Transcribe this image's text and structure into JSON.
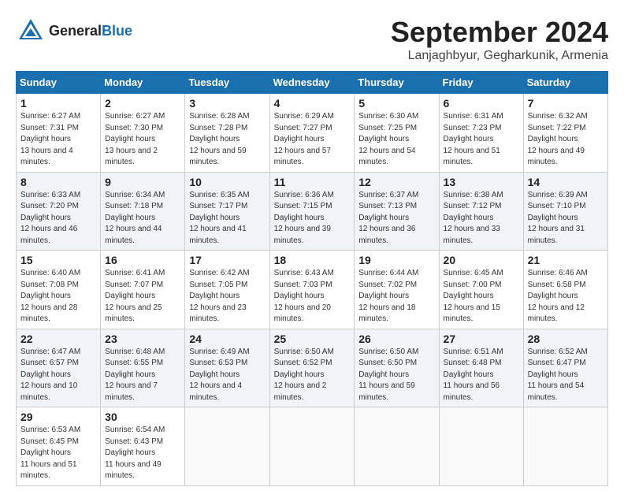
{
  "header": {
    "logo_general": "General",
    "logo_blue": "Blue",
    "month_title": "September 2024",
    "location": "Lanjaghbyur, Gegharkunik, Armenia"
  },
  "weekdays": [
    "Sunday",
    "Monday",
    "Tuesday",
    "Wednesday",
    "Thursday",
    "Friday",
    "Saturday"
  ],
  "weeks": [
    [
      {
        "day": 1,
        "sunrise": "6:27 AM",
        "sunset": "7:31 PM",
        "daylight": "13 hours and 4 minutes"
      },
      {
        "day": 2,
        "sunrise": "6:27 AM",
        "sunset": "7:30 PM",
        "daylight": "13 hours and 2 minutes"
      },
      {
        "day": 3,
        "sunrise": "6:28 AM",
        "sunset": "7:28 PM",
        "daylight": "12 hours and 59 minutes"
      },
      {
        "day": 4,
        "sunrise": "6:29 AM",
        "sunset": "7:27 PM",
        "daylight": "12 hours and 57 minutes"
      },
      {
        "day": 5,
        "sunrise": "6:30 AM",
        "sunset": "7:25 PM",
        "daylight": "12 hours and 54 minutes"
      },
      {
        "day": 6,
        "sunrise": "6:31 AM",
        "sunset": "7:23 PM",
        "daylight": "12 hours and 51 minutes"
      },
      {
        "day": 7,
        "sunrise": "6:32 AM",
        "sunset": "7:22 PM",
        "daylight": "12 hours and 49 minutes"
      }
    ],
    [
      {
        "day": 8,
        "sunrise": "6:33 AM",
        "sunset": "7:20 PM",
        "daylight": "12 hours and 46 minutes"
      },
      {
        "day": 9,
        "sunrise": "6:34 AM",
        "sunset": "7:18 PM",
        "daylight": "12 hours and 44 minutes"
      },
      {
        "day": 10,
        "sunrise": "6:35 AM",
        "sunset": "7:17 PM",
        "daylight": "12 hours and 41 minutes"
      },
      {
        "day": 11,
        "sunrise": "6:36 AM",
        "sunset": "7:15 PM",
        "daylight": "12 hours and 39 minutes"
      },
      {
        "day": 12,
        "sunrise": "6:37 AM",
        "sunset": "7:13 PM",
        "daylight": "12 hours and 36 minutes"
      },
      {
        "day": 13,
        "sunrise": "6:38 AM",
        "sunset": "7:12 PM",
        "daylight": "12 hours and 33 minutes"
      },
      {
        "day": 14,
        "sunrise": "6:39 AM",
        "sunset": "7:10 PM",
        "daylight": "12 hours and 31 minutes"
      }
    ],
    [
      {
        "day": 15,
        "sunrise": "6:40 AM",
        "sunset": "7:08 PM",
        "daylight": "12 hours and 28 minutes"
      },
      {
        "day": 16,
        "sunrise": "6:41 AM",
        "sunset": "7:07 PM",
        "daylight": "12 hours and 25 minutes"
      },
      {
        "day": 17,
        "sunrise": "6:42 AM",
        "sunset": "7:05 PM",
        "daylight": "12 hours and 23 minutes"
      },
      {
        "day": 18,
        "sunrise": "6:43 AM",
        "sunset": "7:03 PM",
        "daylight": "12 hours and 20 minutes"
      },
      {
        "day": 19,
        "sunrise": "6:44 AM",
        "sunset": "7:02 PM",
        "daylight": "12 hours and 18 minutes"
      },
      {
        "day": 20,
        "sunrise": "6:45 AM",
        "sunset": "7:00 PM",
        "daylight": "12 hours and 15 minutes"
      },
      {
        "day": 21,
        "sunrise": "6:46 AM",
        "sunset": "6:58 PM",
        "daylight": "12 hours and 12 minutes"
      }
    ],
    [
      {
        "day": 22,
        "sunrise": "6:47 AM",
        "sunset": "6:57 PM",
        "daylight": "12 hours and 10 minutes"
      },
      {
        "day": 23,
        "sunrise": "6:48 AM",
        "sunset": "6:55 PM",
        "daylight": "12 hours and 7 minutes"
      },
      {
        "day": 24,
        "sunrise": "6:49 AM",
        "sunset": "6:53 PM",
        "daylight": "12 hours and 4 minutes"
      },
      {
        "day": 25,
        "sunrise": "6:50 AM",
        "sunset": "6:52 PM",
        "daylight": "12 hours and 2 minutes"
      },
      {
        "day": 26,
        "sunrise": "6:50 AM",
        "sunset": "6:50 PM",
        "daylight": "11 hours and 59 minutes"
      },
      {
        "day": 27,
        "sunrise": "6:51 AM",
        "sunset": "6:48 PM",
        "daylight": "11 hours and 56 minutes"
      },
      {
        "day": 28,
        "sunrise": "6:52 AM",
        "sunset": "6:47 PM",
        "daylight": "11 hours and 54 minutes"
      }
    ],
    [
      {
        "day": 29,
        "sunrise": "6:53 AM",
        "sunset": "6:45 PM",
        "daylight": "11 hours and 51 minutes"
      },
      {
        "day": 30,
        "sunrise": "6:54 AM",
        "sunset": "6:43 PM",
        "daylight": "11 hours and 49 minutes"
      },
      null,
      null,
      null,
      null,
      null
    ]
  ]
}
